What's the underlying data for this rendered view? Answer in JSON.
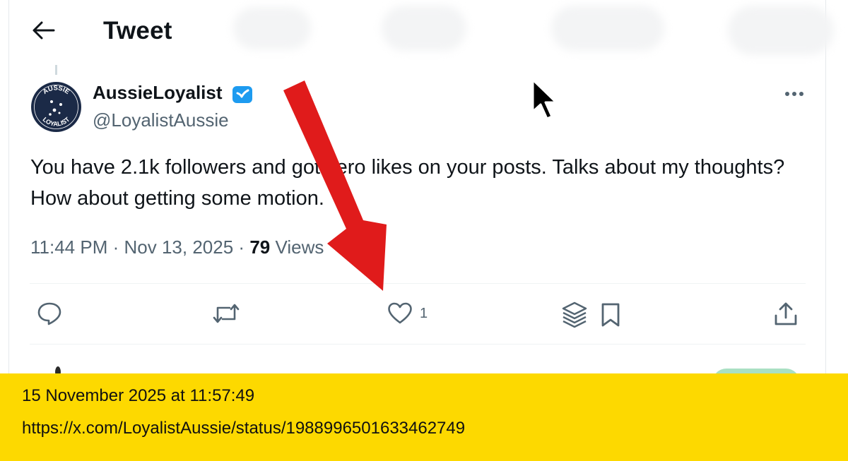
{
  "header": {
    "title": "Tweet",
    "back_icon": "arrow-left-icon"
  },
  "tweet": {
    "author": {
      "display_name": "AussieLoyalist",
      "handle": "@LoyalistAussie",
      "avatar_text": [
        "AUSSIE",
        "LOYALIST"
      ],
      "verified_icon": "verified-badge-icon"
    },
    "text": "You have 2.1k followers and got zero likes on your posts. Talks about my thoughts? How about getting some motion.",
    "time": "11:44 PM",
    "date": "Nov 13, 2025",
    "separator": "·",
    "views_count": "79",
    "views_label": "Views",
    "actions": {
      "reply_icon": "comment-icon",
      "retweet_icon": "retweet-icon",
      "like_icon": "heart-icon",
      "like_count": "1",
      "grok_icon": "layers-icon",
      "bookmark_icon": "bookmark-icon",
      "share_icon": "share-icon"
    }
  },
  "overlay": {
    "annotation": "red-arrow",
    "arrow_color": "#e01b1b",
    "cursor_icon": "mouse-pointer-icon"
  },
  "caption": {
    "timestamp": "15 November 2025 at 11:57:49",
    "url": "https://x.com/LoyalistAussie/status/1988996501633462749",
    "background": "#fdd900"
  },
  "colors": {
    "text_primary": "#0f1419",
    "text_secondary": "#536471",
    "verified_blue": "#1d9bf0"
  }
}
